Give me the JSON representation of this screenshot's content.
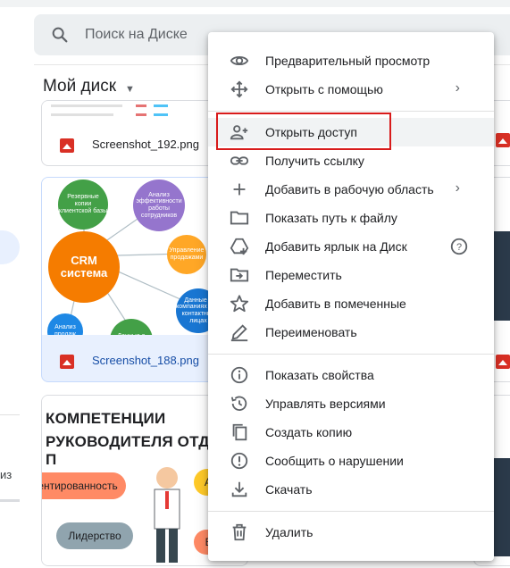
{
  "search": {
    "placeholder": "Поиск на Диске"
  },
  "drive": {
    "title": "Мой диск"
  },
  "rail": {
    "text": "из"
  },
  "files": [
    {
      "name": "Screenshot_192.png"
    },
    {
      "name": "Screenshot_188.png"
    }
  ],
  "mindmap": {
    "center": "CRM система",
    "nodes": [
      "Резервные копии клиентской базы",
      "Анализ эффективности работы сотрудников",
      "Управление продажами",
      "Данные о компаниях и их контактных лицах",
      "Анализ продаж",
      "Данные о сделках"
    ]
  },
  "competence": {
    "title_line1": "КОМПЕТЕНЦИИ",
    "title_line2": "РУКОВОДИТЕЛЯ ОТДЕЛА П",
    "bubbles": [
      "ентированность",
      "Лидерство",
      "Ам",
      "Ва"
    ]
  },
  "menu": {
    "items": [
      {
        "label": "Предварительный просмотр",
        "icon": "eye-icon"
      },
      {
        "label": "Открыть с помощью",
        "icon": "move-arrows-icon",
        "chevron": "›"
      },
      {
        "label": "Открыть доступ",
        "icon": "add-person-icon"
      },
      {
        "label": "Получить ссылку",
        "icon": "link-icon"
      },
      {
        "label": "Добавить в рабочую область",
        "icon": "plus-icon",
        "chevron": "›"
      },
      {
        "label": "Показать путь к файлу",
        "icon": "folder-icon"
      },
      {
        "label": "Добавить ярлык на Диск",
        "icon": "drive-shortcut-icon",
        "help": "?"
      },
      {
        "label": "Переместить",
        "icon": "move-to-folder-icon"
      },
      {
        "label": "Добавить в помеченные",
        "icon": "star-icon"
      },
      {
        "label": "Переименовать",
        "icon": "pencil-icon"
      },
      {
        "label": "Показать свойства",
        "icon": "info-icon"
      },
      {
        "label": "Управлять версиями",
        "icon": "history-icon"
      },
      {
        "label": "Создать копию",
        "icon": "copy-icon"
      },
      {
        "label": "Сообщить о нарушении",
        "icon": "report-icon"
      },
      {
        "label": "Скачать",
        "icon": "download-icon"
      },
      {
        "label": "Удалить",
        "icon": "trash-icon"
      }
    ]
  },
  "colors": {
    "highlight_border": "#d81b1b",
    "accent": "#1a73e8",
    "image_icon": "#d93025"
  }
}
